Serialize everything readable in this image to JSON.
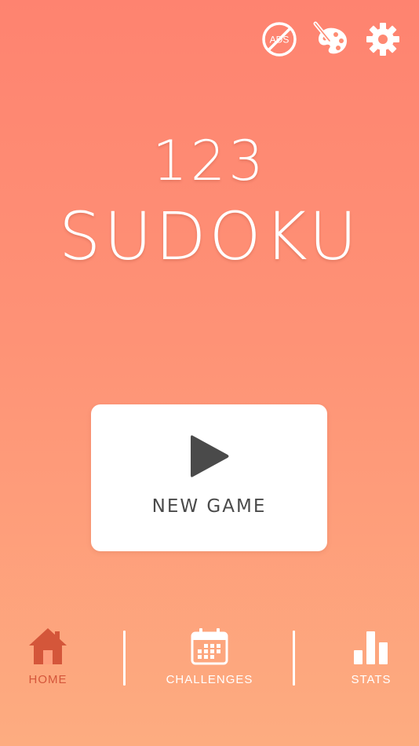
{
  "header": {
    "icons": [
      {
        "name": "no-ads-icon",
        "text": "ADS"
      },
      {
        "name": "theme-palette-icon"
      },
      {
        "name": "settings-gear-icon"
      }
    ]
  },
  "title": {
    "number": "123",
    "word": "SUDOKU"
  },
  "main": {
    "new_game_label": "NEW GAME",
    "play_icon": "play-icon"
  },
  "nav": {
    "items": [
      {
        "label": "HOME",
        "icon": "home-icon",
        "active": true
      },
      {
        "label": "CHALLENGES",
        "icon": "calendar-icon",
        "active": false
      },
      {
        "label": "STATS",
        "icon": "bar-chart-icon",
        "active": false
      }
    ]
  },
  "colors": {
    "gradient_top": "#FE8370",
    "gradient_bottom": "#FDAC80",
    "active_nav": "#D4563A",
    "button_text": "#4A4A4A"
  }
}
